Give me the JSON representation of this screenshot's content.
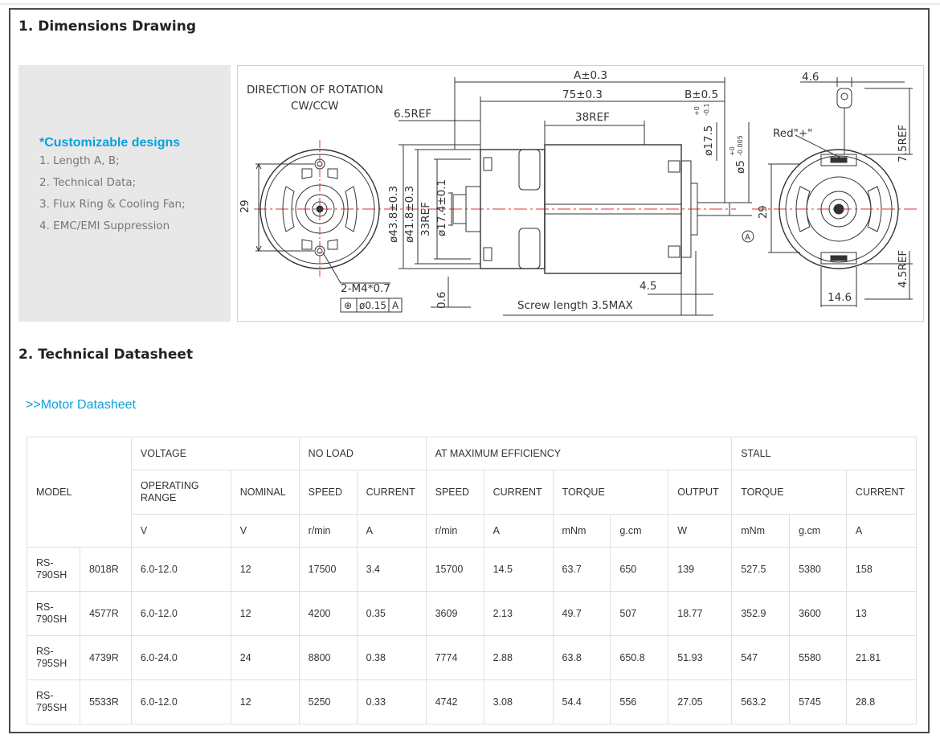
{
  "section1": {
    "title": "1. Dimensions Drawing"
  },
  "customizable": {
    "heading": "*Customizable designs",
    "items": [
      "1. Length A, B;",
      "2. Technical Data;",
      "3. Flux Ring & Cooling Fan;",
      "4. EMC/EMI Suppression"
    ]
  },
  "drawing": {
    "rotation_title": "DIRECTION OF ROTATION",
    "rotation_value": "CW/CCW",
    "dim_a": "A±0.3",
    "dim_75": "75±0.3",
    "dim_b": "B±0.5",
    "dim_38": "38REF",
    "dim_6_5": "6.5REF",
    "dim_29_left": "29",
    "dim_43_8": "ø43.8±0.3",
    "dim_41_8": "ø41.8±0.3",
    "dim_33": "33REF",
    "dim_17_4": "ø17.4±0.1",
    "dim_17_5": "ø17.5",
    "dim_17_5_tol_top": "+0",
    "dim_17_5_tol_bottom": "-0.1",
    "dim_5": "ø5",
    "dim_5_tol_top": "+0",
    "dim_5_tol_bottom": "-0.005",
    "datum": "A",
    "dim_29_right": "29",
    "screw_spec": "2-M4*0.7",
    "tolerance_frame": [
      "⊕",
      "ø0.15",
      "A"
    ],
    "dim_0_6": "0.6",
    "dim_4_5": "4.5",
    "screw_length": "Screw length 3.5MAX",
    "dim_4_6": "4.6",
    "red_label": "Red\"+\"",
    "dim_7_5": "7.5REF",
    "dim_4_5_ref": "4.5REF",
    "dim_14_6": "14.6"
  },
  "section2": {
    "title": "2. Technical Datasheet"
  },
  "datasheet_link": ">>Motor Datasheet",
  "table": {
    "header_groups": {
      "model": "MODEL",
      "voltage": "VOLTAGE",
      "no_load": "NO LOAD",
      "max_eff": "AT MAXIMUM EFFICIENCY",
      "stall": "STALL"
    },
    "header_cols": {
      "operating_range": "OPERATING RANGE",
      "nominal": "NOMINAL",
      "nl_speed": "SPEED",
      "nl_current": "CURRENT",
      "me_speed": "SPEED",
      "me_current": "CURRENT",
      "me_torque": "TORQUE",
      "me_output": "OUTPUT",
      "st_torque": "TORQUE",
      "st_current": "CURRENT"
    },
    "units": {
      "operating_range": "V",
      "nominal": "V",
      "nl_speed": "r/min",
      "nl_current": "A",
      "me_speed": "r/min",
      "me_current": "A",
      "me_torque_mnm": "mNm",
      "me_torque_gcm": "g.cm",
      "me_output": "W",
      "st_torque_mnm": "mNm",
      "st_torque_gcm": "g.cm",
      "st_current": "A"
    },
    "rows": [
      {
        "series": "RS-790SH",
        "code": "8018R",
        "range": "6.0-12.0",
        "nominal": "12",
        "nl_speed": "17500",
        "nl_current": "3.4",
        "me_speed": "15700",
        "me_current": "14.5",
        "me_torque_mnm": "63.7",
        "me_torque_gcm": "650",
        "output": "139",
        "st_torque_mnm": "527.5",
        "st_torque_gcm": "5380",
        "st_current": "158"
      },
      {
        "series": "RS-790SH",
        "code": "4577R",
        "range": "6.0-12.0",
        "nominal": "12",
        "nl_speed": "4200",
        "nl_current": "0.35",
        "me_speed": "3609",
        "me_current": "2.13",
        "me_torque_mnm": "49.7",
        "me_torque_gcm": "507",
        "output": "18.77",
        "st_torque_mnm": "352.9",
        "st_torque_gcm": "3600",
        "st_current": "13"
      },
      {
        "series": "RS-795SH",
        "code": "4739R",
        "range": "6.0-24.0",
        "nominal": "24",
        "nl_speed": "8800",
        "nl_current": "0.38",
        "me_speed": "7774",
        "me_current": "2.88",
        "me_torque_mnm": "63.8",
        "me_torque_gcm": "650.8",
        "output": "51.93",
        "st_torque_mnm": "547",
        "st_torque_gcm": "5580",
        "st_current": "21.81"
      },
      {
        "series": "RS-795SH",
        "code": "5533R",
        "range": "6.0-12.0",
        "nominal": "12",
        "nl_speed": "5250",
        "nl_current": "0.33",
        "me_speed": "4742",
        "me_current": "3.08",
        "me_torque_mnm": "54.4",
        "me_torque_gcm": "556",
        "output": "27.05",
        "st_torque_mnm": "563.2",
        "st_torque_gcm": "5745",
        "st_current": "28.8"
      }
    ]
  }
}
